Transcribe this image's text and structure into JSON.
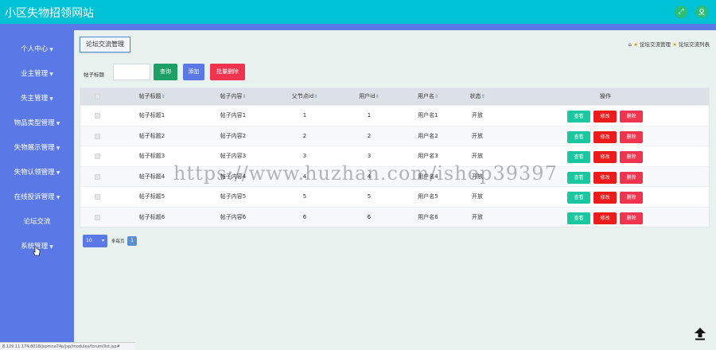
{
  "app": {
    "title": "小区失物招领网站"
  },
  "header": {
    "fullscreen_icon": "expand-icon",
    "user_icon": "user-icon"
  },
  "sidebar": {
    "items": [
      {
        "label": "个人中心",
        "has_submenu": true
      },
      {
        "label": "业主管理",
        "has_submenu": true
      },
      {
        "label": "失主管理",
        "has_submenu": true
      },
      {
        "label": "物品类型管理",
        "has_submenu": true
      },
      {
        "label": "失物展示管理",
        "has_submenu": true
      },
      {
        "label": "失物认领管理",
        "has_submenu": true
      },
      {
        "label": "在线投诉管理",
        "has_submenu": true
      },
      {
        "label": "论坛交流",
        "has_submenu": false
      },
      {
        "label": "系统管理",
        "has_submenu": true
      }
    ]
  },
  "status_url": "8.129.11.174:8018/jspmna74p/jsp/modules/forum/list.jsp#",
  "page": {
    "tag": "论坛交流管理",
    "breadcrumb": [
      "论坛交流管理",
      "论坛交流列表"
    ]
  },
  "search": {
    "label": "帖子标题",
    "value": "",
    "query_label": "查询",
    "add_label": "添加",
    "batch_delete_label": "批量删除"
  },
  "table": {
    "columns": [
      "帖子标题",
      "帖子内容",
      "父节点id",
      "用户id",
      "用户名",
      "状态"
    ],
    "actions_header": "操作",
    "action_labels": {
      "view": "查看",
      "edit": "修改",
      "delete": "删除"
    },
    "rows": [
      [
        "帖子标题1",
        "帖子内容1",
        "1",
        "1",
        "用户名1",
        "开放"
      ],
      [
        "帖子标题2",
        "帖子内容2",
        "2",
        "2",
        "用户名2",
        "开放"
      ],
      [
        "帖子标题3",
        "帖子内容3",
        "3",
        "3",
        "用户名3",
        "开放"
      ],
      [
        "帖子标题4",
        "帖子内容4",
        "4",
        "4",
        "用户名4",
        "开放"
      ],
      [
        "帖子标题5",
        "帖子内容5",
        "5",
        "5",
        "用户名5",
        "开放"
      ],
      [
        "帖子标题6",
        "帖子内容6",
        "6",
        "6",
        "用户名6",
        "开放"
      ]
    ]
  },
  "pager": {
    "page_size": "10",
    "label": "条每页",
    "current": "1"
  },
  "watermark": "https://www.huzhan.com/ishop39397",
  "colors": {
    "topbar": "#00c2d6",
    "sidebar": "#5b79e6",
    "query": "#1e9f65",
    "add": "#5b79e6",
    "delete": "#f0334e",
    "view": "#19c8a0",
    "edit": "#ec1c1c"
  }
}
